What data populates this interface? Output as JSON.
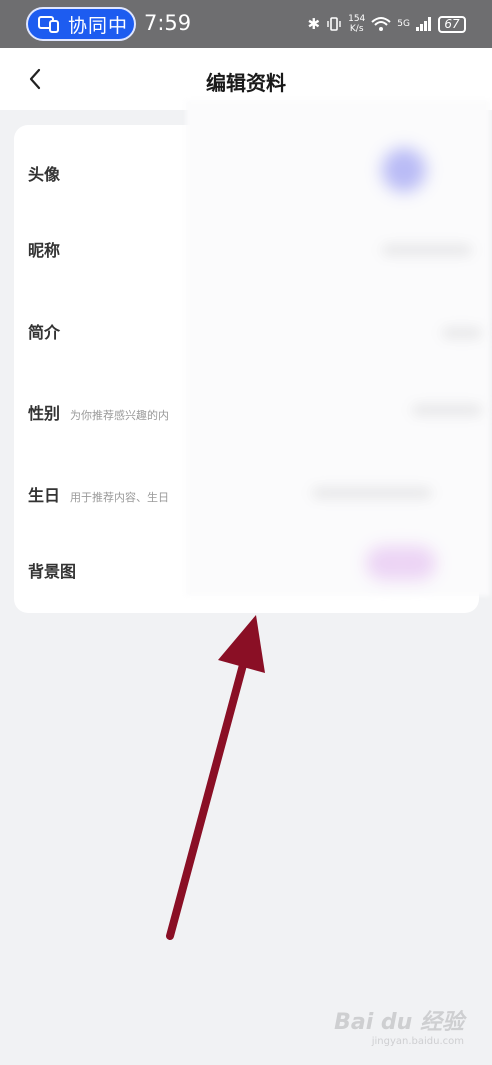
{
  "status_bar": {
    "collab_label": "协同中",
    "time": "7:59",
    "net_speed_value": "154",
    "net_speed_unit": "K/s",
    "network": "5G",
    "battery": "67"
  },
  "header": {
    "title": "编辑资料"
  },
  "profile_rows": [
    {
      "label": "头像",
      "hint": ""
    },
    {
      "label": "昵称",
      "hint": ""
    },
    {
      "label": "简介",
      "hint": ""
    },
    {
      "label": "性别",
      "hint": "为你推荐感兴趣的内"
    },
    {
      "label": "生日",
      "hint": "用于推荐内容、生日"
    },
    {
      "label": "背景图",
      "hint": ""
    }
  ],
  "watermark": {
    "text": "Bai du 经验",
    "sub": "jingyan.baidu.com"
  },
  "colors": {
    "status_bg": "#6e6e70",
    "collab_blue": "#1d5cf0",
    "page_bg": "#f1f2f4",
    "arrow": "#8a0f25"
  }
}
